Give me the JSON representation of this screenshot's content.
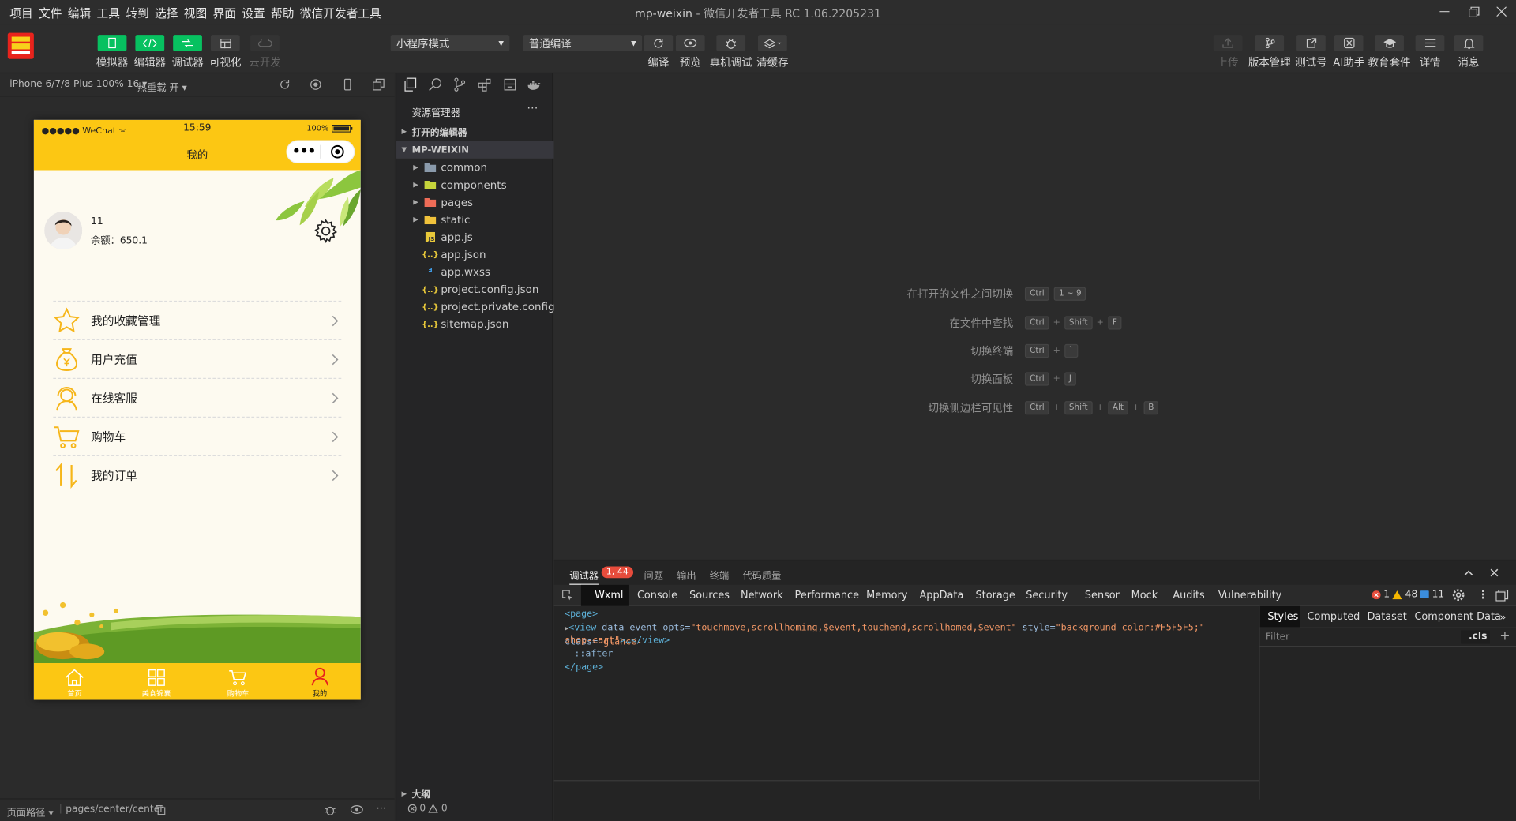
{
  "menubar": {
    "items": [
      "项目",
      "文件",
      "编辑",
      "工具",
      "转到",
      "选择",
      "视图",
      "界面",
      "设置",
      "帮助",
      "微信开发者工具"
    ],
    "title_project": "mp-weixin",
    "title_app": " - 微信开发者工具 RC 1.06.2205231"
  },
  "toolbar": {
    "left_buttons": [
      "模拟器",
      "编辑器",
      "调试器",
      "可视化",
      "云开发"
    ],
    "mode_select": "小程序模式",
    "compile_select": "普通编译",
    "mid_buttons": [
      "编译",
      "预览",
      "真机调试",
      "清缓存"
    ],
    "right_buttons": [
      "上传",
      "版本管理",
      "测试号",
      "AI助手",
      "教育套件",
      "详情",
      "消息"
    ]
  },
  "simbar": {
    "device": "iPhone 6/7/8 Plus 100% 16 ▾",
    "hotreload": "热重载 开 ▾"
  },
  "phone": {
    "carrier": "●●●●● WeChat",
    "time": "15:59",
    "battery": "100%",
    "nav_title": "我的",
    "user_name": "11",
    "user_balance": "余额：650.1",
    "menu": [
      {
        "label": "我的收藏管理",
        "icon": "star-icon"
      },
      {
        "label": "用户充值",
        "icon": "money-bag-icon"
      },
      {
        "label": "在线客服",
        "icon": "customer-service-icon"
      },
      {
        "label": "购物车",
        "icon": "cart-icon"
      },
      {
        "label": "我的订单",
        "icon": "orders-icon"
      }
    ],
    "tabs": [
      {
        "label": "首页",
        "icon": "home-icon"
      },
      {
        "label": "美食锦囊",
        "icon": "grid-icon"
      },
      {
        "label": "购物车",
        "icon": "cart-icon"
      },
      {
        "label": "我的",
        "icon": "user-icon"
      }
    ]
  },
  "statusbar": {
    "path_label": "页面路径 ▾",
    "path": "pages/center/center"
  },
  "explorer": {
    "title": "资源管理器",
    "more": "···",
    "open_editors": "打开的编辑器",
    "project": "MP-WEIXIN",
    "items": [
      {
        "name": "common",
        "kind": "folder"
      },
      {
        "name": "components",
        "kind": "folder"
      },
      {
        "name": "pages",
        "kind": "folder"
      },
      {
        "name": "static",
        "kind": "folder"
      },
      {
        "name": "app.js",
        "kind": "js"
      },
      {
        "name": "app.json",
        "kind": "json"
      },
      {
        "name": "app.wxss",
        "kind": "wxss"
      },
      {
        "name": "project.config.json",
        "kind": "json"
      },
      {
        "name": "project.private.config.js...",
        "kind": "json"
      },
      {
        "name": "sitemap.json",
        "kind": "json"
      }
    ],
    "outline": "大纲",
    "problems": "0",
    "warnings": "0"
  },
  "editor": {
    "hints": [
      {
        "label": "在打开的文件之间切换",
        "keys": [
          "Ctrl",
          "1 ~ 9"
        ],
        "plus": false
      },
      {
        "label": "在文件中查找",
        "keys": [
          "Ctrl",
          "Shift",
          "F"
        ],
        "plus": true
      },
      {
        "label": "切换终端",
        "keys": [
          "Ctrl",
          "`"
        ],
        "plus": true
      },
      {
        "label": "切换面板",
        "keys": [
          "Ctrl",
          "J"
        ],
        "plus": true
      },
      {
        "label": "切换侧边栏可见性",
        "keys": [
          "Ctrl",
          "Shift",
          "Alt",
          "B"
        ],
        "plus": true
      }
    ]
  },
  "debugger": {
    "tabs": [
      "调试器",
      "问题",
      "输出",
      "终端",
      "代码质量"
    ],
    "badge": "1, 44",
    "devtabs": [
      "Wxml",
      "Console",
      "Sources",
      "Network",
      "Performance",
      "Memory",
      "AppData",
      "Storage",
      "Security",
      "Sensor",
      "Mock",
      "Audits",
      "Vulnerability"
    ],
    "err_count": "1",
    "warn_count": "48",
    "info_count": "11",
    "wxml": {
      "page_open": "<page>",
      "view_tag": "<view",
      "attr1": " data-event-opts=",
      "val1": "\"touchmove,scrollhoming,$event,touchend,scrollhomed,$event\"",
      "attr2": " style=",
      "val2": "\"background-color:#F5F5F5;\"",
      "attr3": " class=",
      "val3a": "\"glance-",
      "val3b": "shop-cart\"",
      "view_close": ">…</view>",
      "after": "::after",
      "page_close": "</page>"
    },
    "style_tabs": [
      "Styles",
      "Computed",
      "Dataset",
      "Component Data"
    ],
    "filter": "Filter",
    "cls": ".cls",
    "add": "+"
  },
  "colors": {
    "accent": "#07c160",
    "phone_yellow": "#fcc713",
    "error": "#e74c3c"
  }
}
